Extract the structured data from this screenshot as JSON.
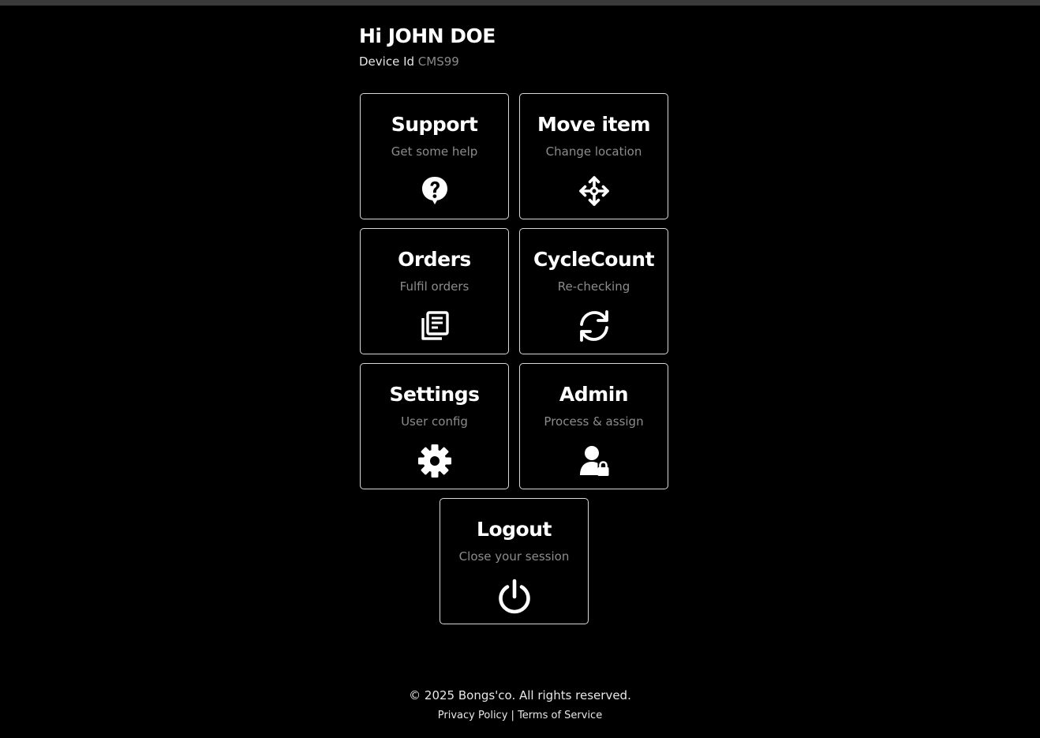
{
  "header": {
    "greeting": "Hi JOHN DOE",
    "device_label": "Device Id",
    "device_value": "CMS99"
  },
  "tiles": [
    {
      "title": "Support",
      "subtitle": "Get some help",
      "icon": "question-icon"
    },
    {
      "title": "Move item",
      "subtitle": "Change location",
      "icon": "move-arrows-icon"
    },
    {
      "title": "Orders",
      "subtitle": "Fulfil orders",
      "icon": "documents-icon"
    },
    {
      "title": "CycleCount",
      "subtitle": "Re-checking",
      "icon": "refresh-icon"
    },
    {
      "title": "Settings",
      "subtitle": "User config",
      "icon": "gear-icon"
    },
    {
      "title": "Admin",
      "subtitle": "Process & assign",
      "icon": "user-lock-icon"
    },
    {
      "title": "Logout",
      "subtitle": "Close your session",
      "icon": "power-icon"
    }
  ],
  "footer": {
    "copyright": "© 2025 Bongs'co. All rights reserved.",
    "privacy": "Privacy Policy",
    "separator": "|",
    "terms": "Terms of Service"
  },
  "colors": {
    "background": "#000000",
    "tile_border": "#d8d8d8",
    "subtitle": "#8c8c8c",
    "device_value": "#8a8a8a"
  }
}
